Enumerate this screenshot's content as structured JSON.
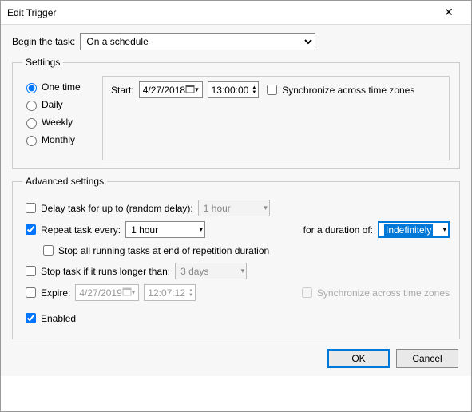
{
  "window": {
    "title": "Edit Trigger"
  },
  "begin": {
    "label": "Begin the task:",
    "value": "On a schedule"
  },
  "settings": {
    "legend": "Settings",
    "schedule": {
      "one_time": "One time",
      "daily": "Daily",
      "weekly": "Weekly",
      "monthly": "Monthly"
    },
    "start_label": "Start:",
    "date": "4/27/2018",
    "time": "13:00:00",
    "sync_label": "Synchronize across time zones"
  },
  "advanced": {
    "legend": "Advanced settings",
    "delay_label": "Delay task for up to (random delay):",
    "delay_value": "1 hour",
    "repeat_label": "Repeat task every:",
    "repeat_value": "1 hour",
    "duration_label": "for a duration of:",
    "duration_value": "Indefinitely",
    "stop_repetition": "Stop all running tasks at end of repetition duration",
    "stop_longer_label": "Stop task if it runs longer than:",
    "stop_longer_value": "3 days",
    "expire_label": "Expire:",
    "expire_date": "4/27/2019",
    "expire_time": "12:07:12",
    "expire_sync": "Synchronize across time zones",
    "enabled_label": "Enabled"
  },
  "buttons": {
    "ok": "OK",
    "cancel": "Cancel"
  }
}
